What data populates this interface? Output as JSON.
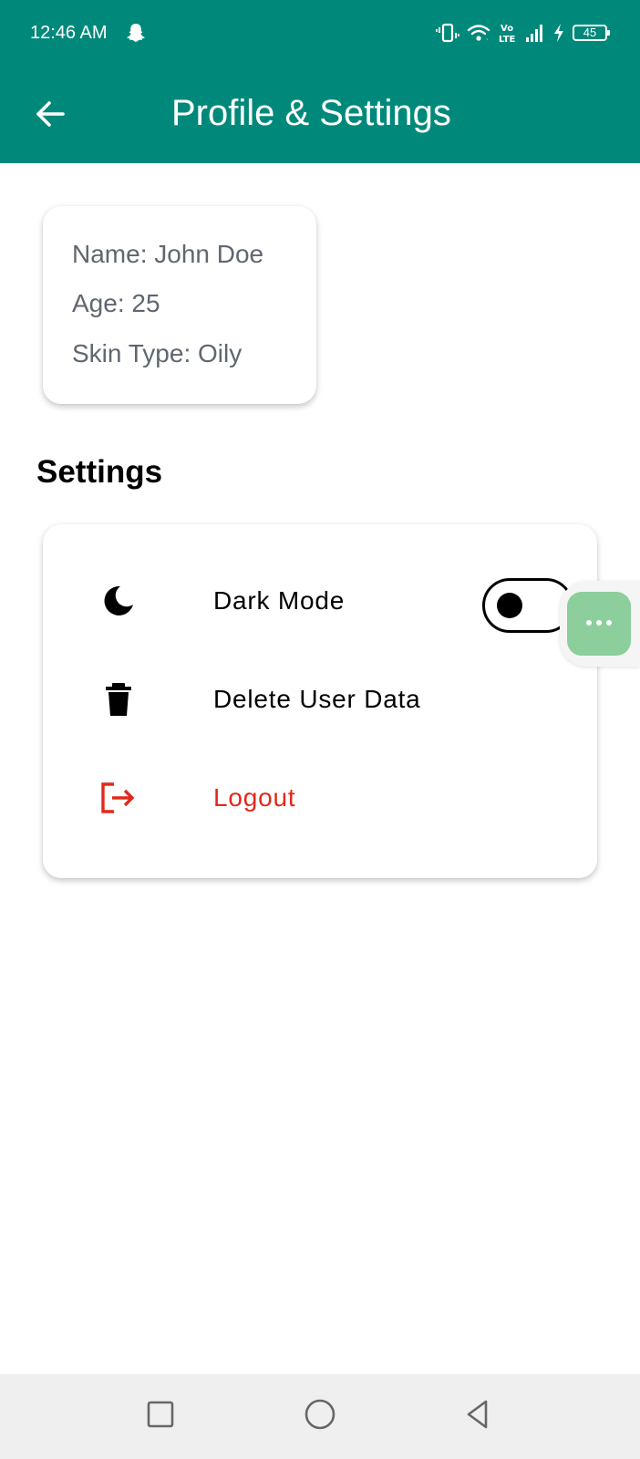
{
  "status_bar": {
    "time": "12:46 AM",
    "battery_level": "45",
    "icons": [
      "snapchat-icon",
      "vibrate-icon",
      "wifi-icon",
      "volte-icon",
      "signal-icon",
      "charging-icon",
      "battery-icon"
    ]
  },
  "header": {
    "title": "Profile & Settings",
    "back_icon": "arrow-left-icon",
    "background_color": "#00897b"
  },
  "profile": {
    "name": "Name: John Doe",
    "age": "Age: 25",
    "skin_type": "Skin Type: Oily"
  },
  "settings": {
    "title": "Settings",
    "dark_mode": {
      "label": "Dark Mode",
      "icon": "moon-icon",
      "enabled": false
    },
    "delete_data": {
      "label": "Delete User Data",
      "icon": "trash-icon"
    },
    "logout": {
      "label": "Logout",
      "icon": "logout-icon",
      "color": "#e0291b"
    }
  },
  "floating_button": {
    "icon": "more-dots-icon",
    "color": "#8ccf9c"
  },
  "nav_bar": {
    "icons": [
      "recent-apps-icon",
      "home-icon",
      "back-triangle-icon"
    ]
  }
}
